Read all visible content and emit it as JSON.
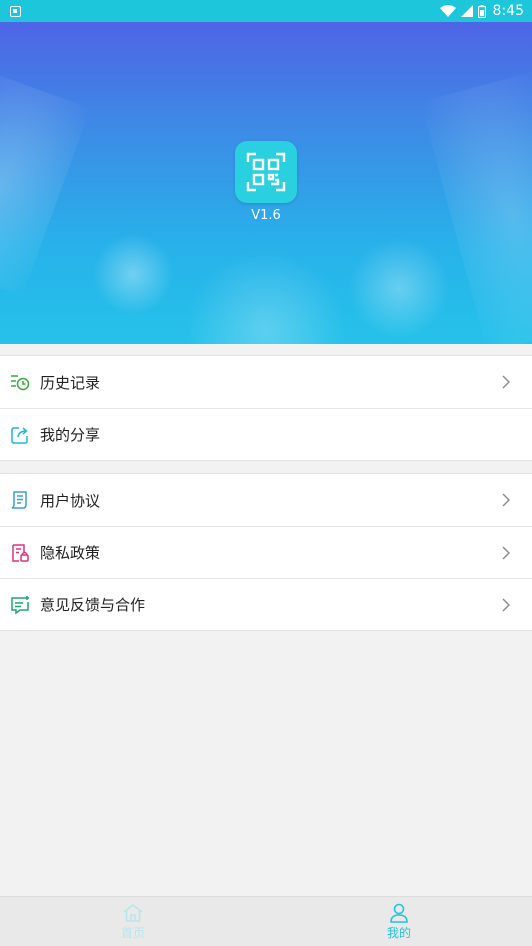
{
  "status_bar": {
    "time": "8:45"
  },
  "header": {
    "version": "V1.6"
  },
  "menu_group1": [
    {
      "label": "历史记录",
      "icon": "history-icon",
      "has_chevron": true
    },
    {
      "label": "我的分享",
      "icon": "share-icon",
      "has_chevron": false
    }
  ],
  "menu_group2": [
    {
      "label": "用户协议",
      "icon": "agreement-icon",
      "has_chevron": true
    },
    {
      "label": "隐私政策",
      "icon": "privacy-icon",
      "has_chevron": true
    },
    {
      "label": "意见反馈与合作",
      "icon": "feedback-icon",
      "has_chevron": true
    }
  ],
  "bottom_nav": {
    "home_label": "首页",
    "mine_label": "我的",
    "active": "我的"
  },
  "colors": {
    "accent": "#1ec6dc",
    "history_icon": "#3aa83a",
    "share_icon": "#20b7d6",
    "agreement_icon": "#3a9fd8",
    "privacy_icon": "#e0307a",
    "feedback_icon": "#1aa86a"
  }
}
